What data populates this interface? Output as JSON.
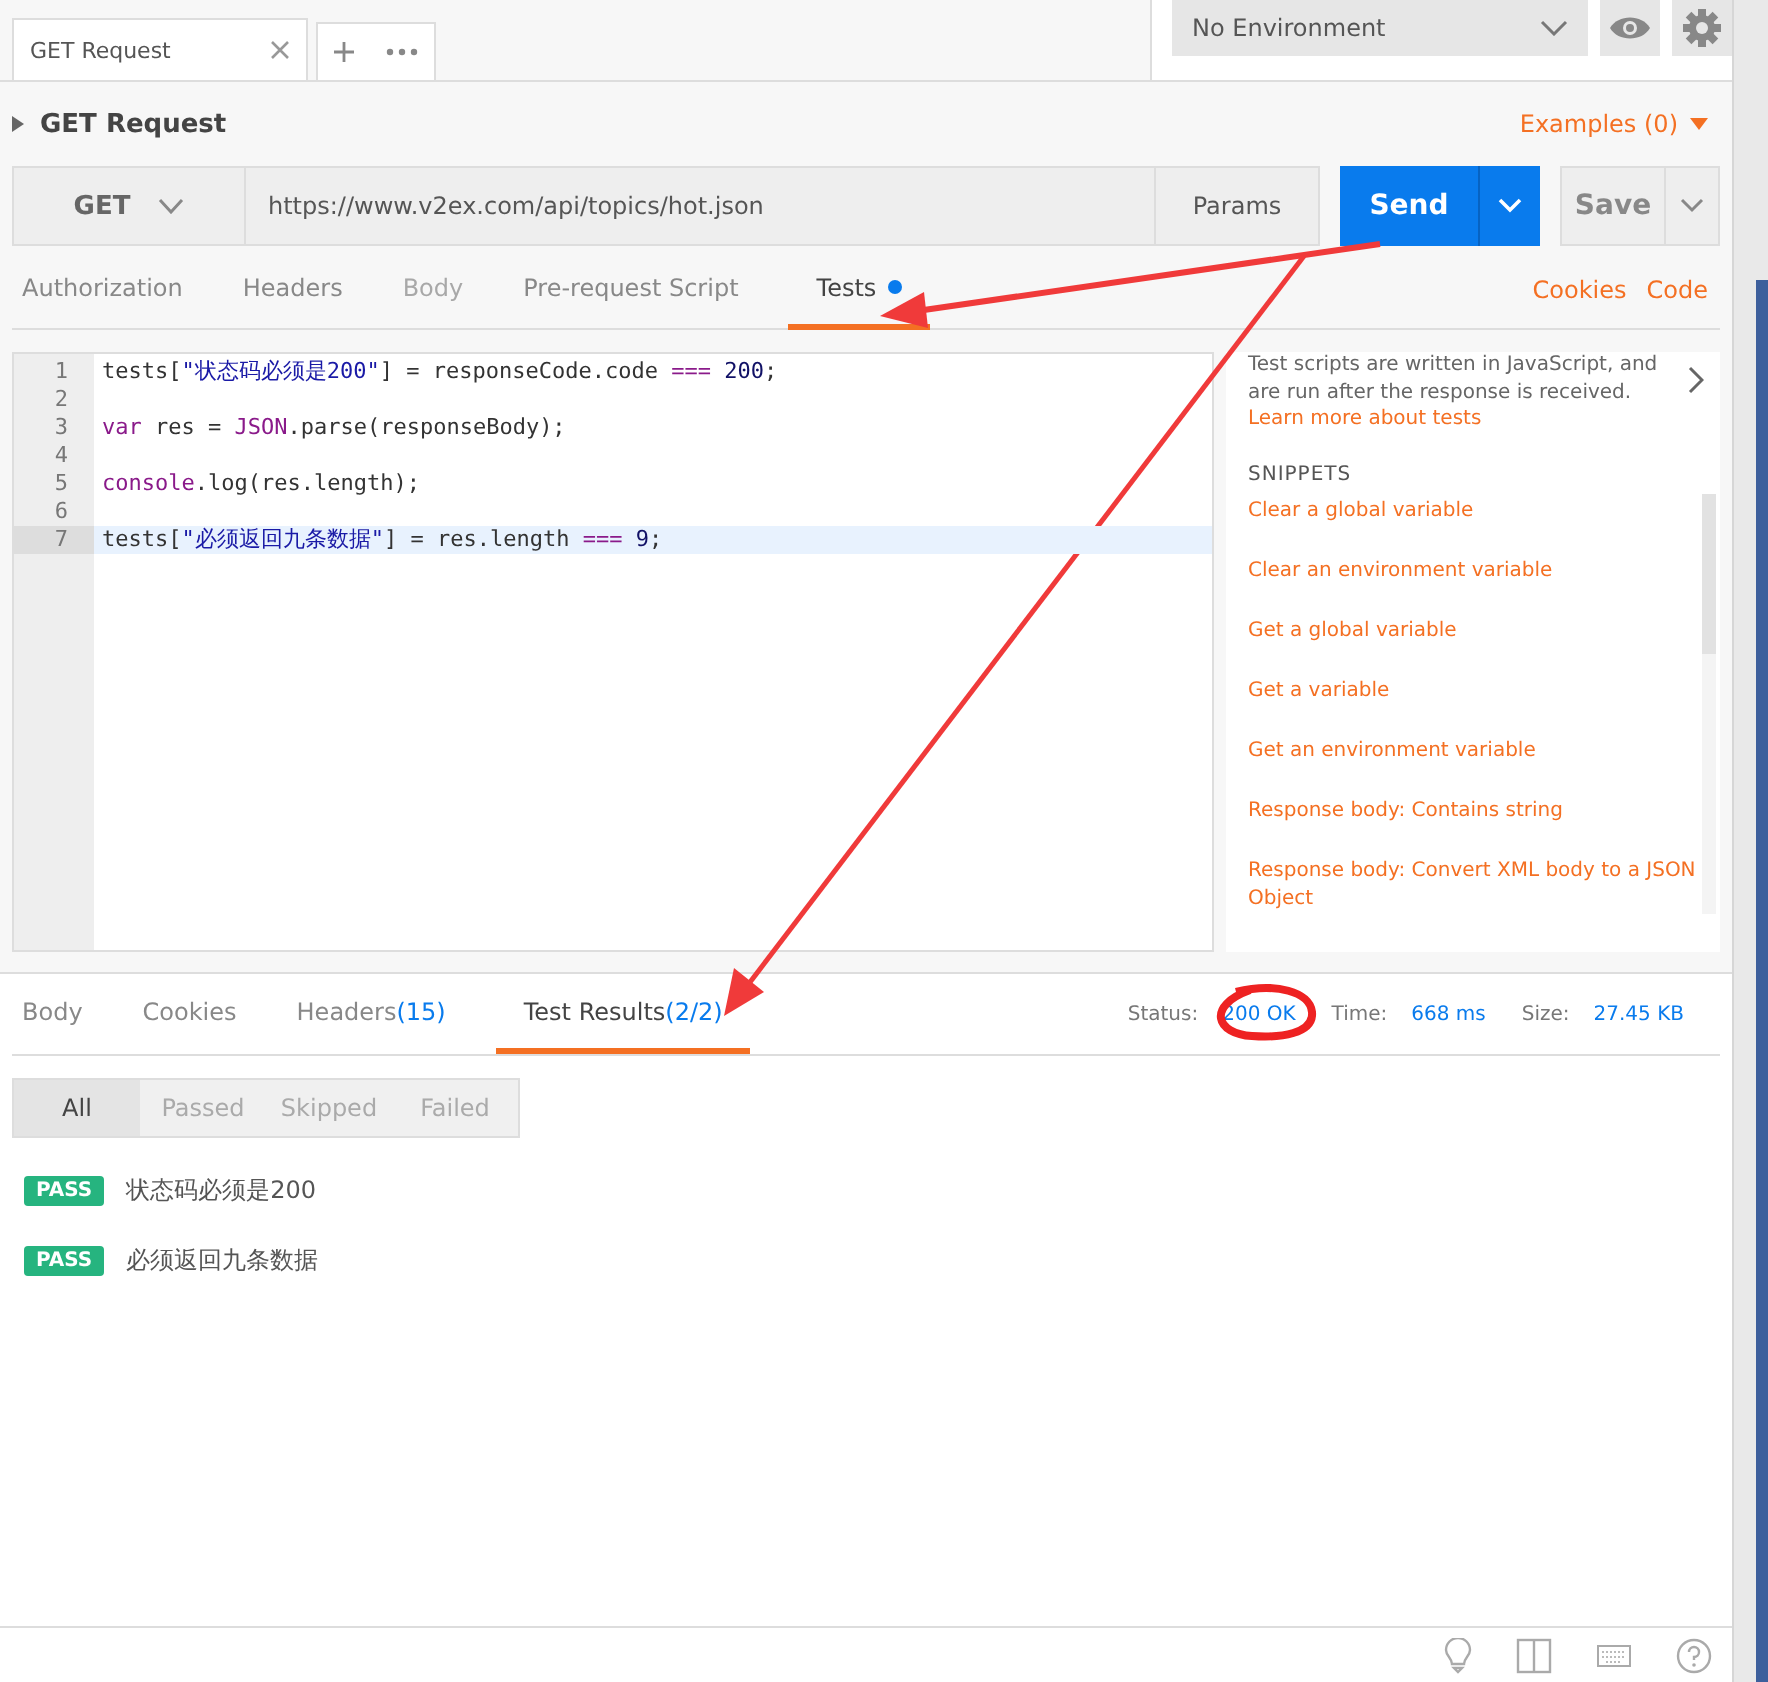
{
  "tabs": [
    {
      "label": "GET Request",
      "selected": true
    }
  ],
  "environment": {
    "value": "No Environment"
  },
  "request": {
    "name": "GET Request",
    "examples": "Examples (0)",
    "method": "GET",
    "url": "https://www.v2ex.com/api/topics/hot.json",
    "params": "Params",
    "send": "Send",
    "save": "Save"
  },
  "request_tabs": [
    {
      "label": "Authorization",
      "selected": false,
      "disabled": false,
      "dot": false
    },
    {
      "label": "Headers",
      "selected": false,
      "disabled": false,
      "dot": false
    },
    {
      "label": "Body",
      "selected": false,
      "disabled": true,
      "dot": false
    },
    {
      "label": "Pre-request Script",
      "selected": false,
      "disabled": false,
      "dot": false
    },
    {
      "label": "Tests",
      "selected": true,
      "disabled": false,
      "dot": true
    }
  ],
  "request_links": [
    "Cookies",
    "Code"
  ],
  "editor": {
    "lines": [
      {
        "number": "1",
        "active": false,
        "tokens": [
          {
            "kind": "plain",
            "text": "tests["
          },
          {
            "kind": "string",
            "text": "\"状态码必须是200\""
          },
          {
            "kind": "plain",
            "text": "] = responseCode.code "
          },
          {
            "kind": "keyword",
            "text": "==="
          },
          {
            "kind": "number",
            "text": " 200"
          },
          {
            "kind": "plain",
            "text": ";"
          }
        ]
      },
      {
        "number": "2",
        "active": false
      },
      {
        "number": "3",
        "active": false,
        "tokens": [
          {
            "kind": "keyword",
            "text": "var"
          },
          {
            "kind": "plain",
            "text": " res = "
          },
          {
            "kind": "keyword",
            "text": "JSON"
          },
          {
            "kind": "plain",
            "text": ".parse(responseBody);"
          }
        ]
      },
      {
        "number": "4",
        "active": false
      },
      {
        "number": "5",
        "active": false,
        "tokens": [
          {
            "kind": "keyword",
            "text": "console"
          },
          {
            "kind": "plain",
            "text": ".log(res.length);"
          }
        ]
      },
      {
        "number": "6",
        "active": false
      },
      {
        "number": "7",
        "active": true,
        "tokens": [
          {
            "kind": "plain",
            "text": "tests["
          },
          {
            "kind": "string",
            "text": "\"必须返回九条数据\""
          },
          {
            "kind": "plain",
            "text": "] = res.length "
          },
          {
            "kind": "keyword",
            "text": "==="
          },
          {
            "kind": "number",
            "text": " 9"
          },
          {
            "kind": "plain",
            "text": ";"
          }
        ]
      }
    ]
  },
  "snippets_panel": {
    "intro": "Test scripts are written in JavaScript, and are run after the response is received.",
    "learn_more": "Learn more about tests",
    "heading": "SNIPPETS",
    "items": [
      "Clear a global variable",
      "Clear an environment variable",
      "Get a global variable",
      "Get a variable",
      "Get an environment variable",
      "Response body: Contains string",
      "Response body: Convert XML body to a JSON Object"
    ]
  },
  "response_tabs": [
    {
      "label": "Body",
      "selected": false
    },
    {
      "label": "Cookies",
      "selected": false
    },
    {
      "label": "Headers",
      "count": "(15)",
      "selected": false
    },
    {
      "label": "Test Results",
      "count": "(2/2)",
      "selected": true
    }
  ],
  "response_meta": [
    {
      "label": "Status:",
      "value": "200 OK"
    },
    {
      "label": "Time:",
      "value": "668 ms"
    },
    {
      "label": "Size:",
      "value": "27.45 KB"
    }
  ],
  "filters": [
    {
      "label": "All",
      "selected": true
    },
    {
      "label": "Passed",
      "selected": false
    },
    {
      "label": "Skipped",
      "selected": false
    },
    {
      "label": "Failed",
      "selected": false
    }
  ],
  "results": [
    {
      "badge": "PASS",
      "name": "状态码必须是200"
    },
    {
      "badge": "PASS",
      "name": "必须返回九条数据"
    }
  ]
}
